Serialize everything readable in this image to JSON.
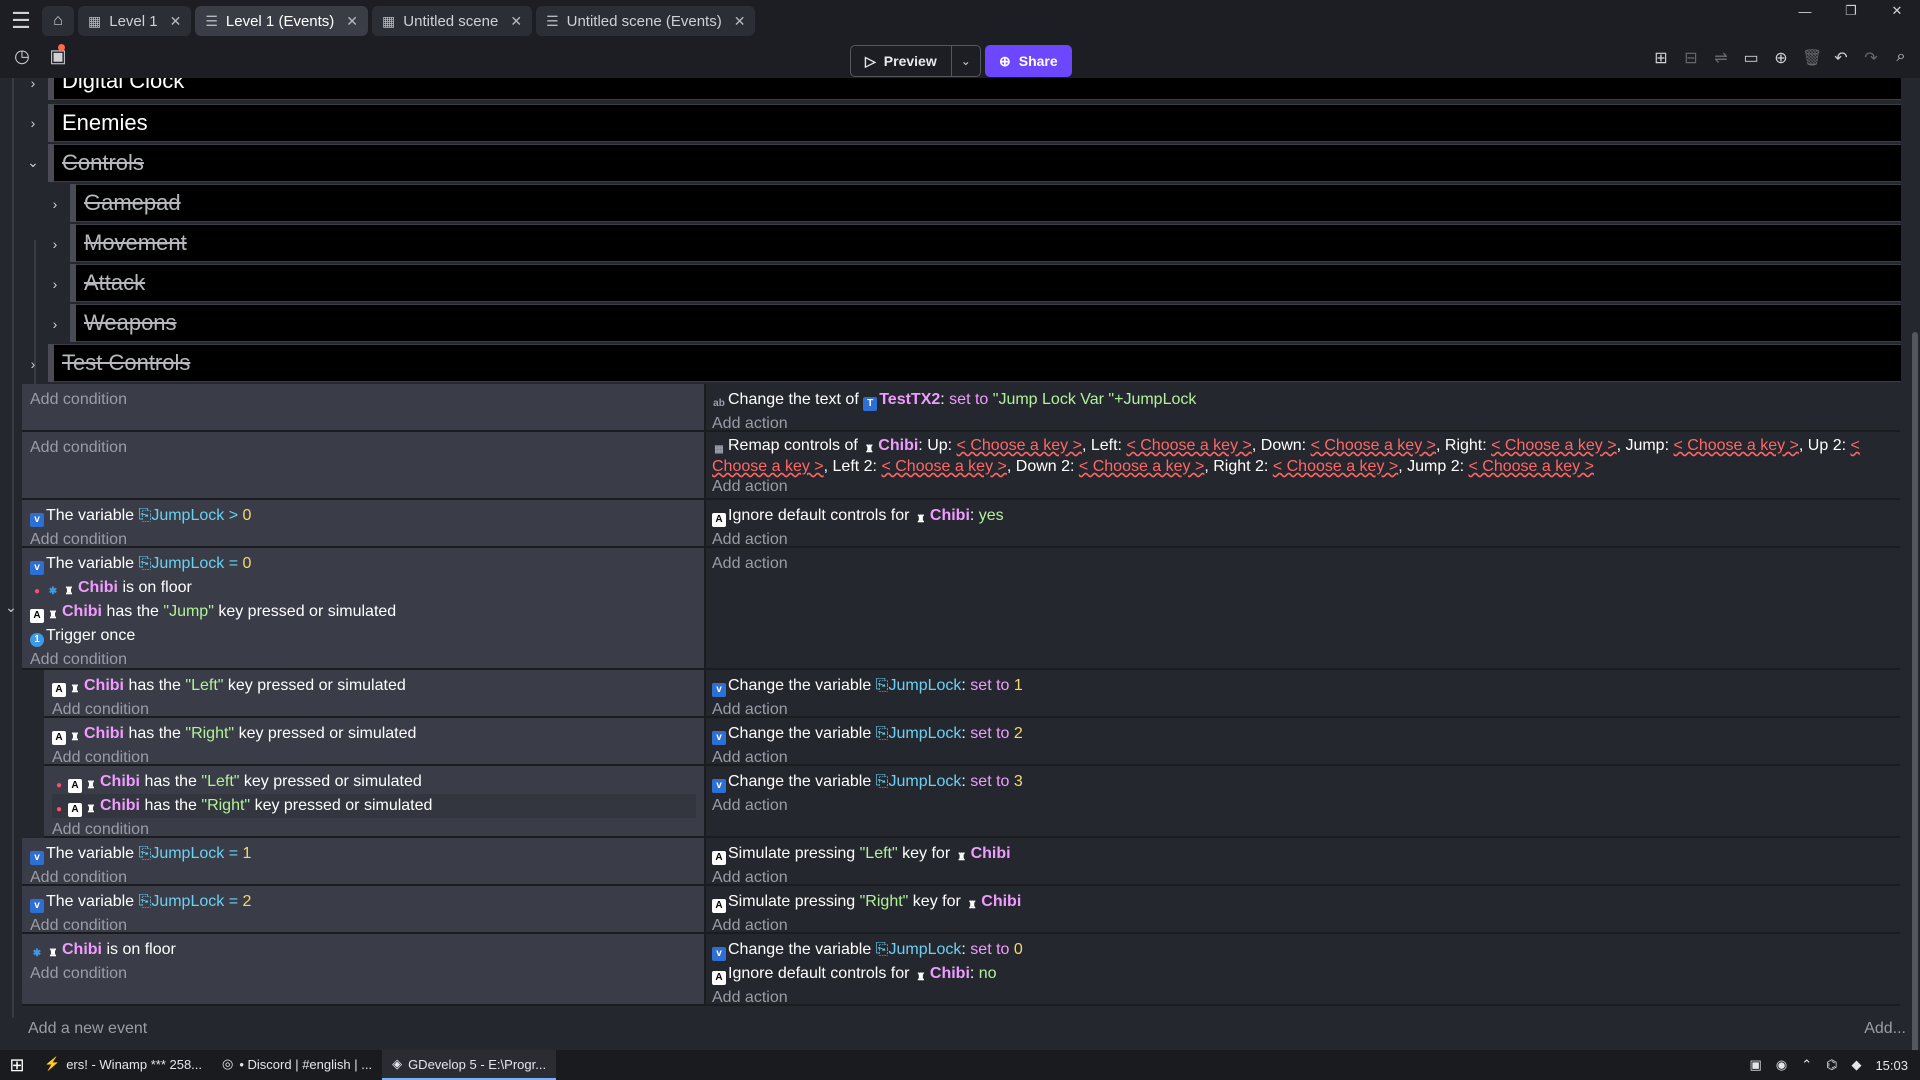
{
  "tabs": [
    {
      "label": "Level 1",
      "icon": "scene-icon"
    },
    {
      "label": "Level 1 (Events)",
      "icon": "events-icon",
      "active": true
    },
    {
      "label": "Untitled scene",
      "icon": "scene-icon"
    },
    {
      "label": "Untitled scene (Events)",
      "icon": "events-icon"
    }
  ],
  "toolbar": {
    "preview": "Preview",
    "share": "Share"
  },
  "groups": [
    {
      "title": "Digital Clock",
      "disabled": false,
      "level": 0,
      "expanded": false
    },
    {
      "title": "Enemies",
      "disabled": false,
      "level": 0,
      "expanded": false
    },
    {
      "title": "Controls",
      "disabled": true,
      "level": 0,
      "expanded": true
    },
    {
      "title": "Gamepad",
      "disabled": true,
      "level": 1,
      "expanded": false
    },
    {
      "title": "Movement",
      "disabled": true,
      "level": 1,
      "expanded": false
    },
    {
      "title": "Attack",
      "disabled": true,
      "level": 1,
      "expanded": false
    },
    {
      "title": "Weapons",
      "disabled": true,
      "level": 1,
      "expanded": false
    },
    {
      "title": "Test Controls",
      "disabled": true,
      "level": 0,
      "expanded": false
    }
  ],
  "labels": {
    "add_condition": "Add condition",
    "add_action": "Add action",
    "add_event": "Add a new event",
    "add_more": "Add..."
  },
  "text": {
    "change_text_of": "Change the text of",
    "testtx2": "TestTX2",
    "set_to": "set to",
    "jump_lock_expr": "\"Jump Lock Var \"+JumpLock",
    "remap_controls_of": "Remap controls of",
    "chibi": "Chibi",
    "up": "Up:",
    "left": "Left:",
    "down": "Down:",
    "right": "Right:",
    "jump": "Jump:",
    "up2": "Up 2:",
    "left2": "Left 2:",
    "down2": "Down 2:",
    "right2": "Right 2:",
    "jump2": "Jump 2:",
    "choose_key": "< Choose a key >",
    "ignore_default": "Ignore default controls for",
    "yes": "yes",
    "no": "no",
    "the_variable": "The variable",
    "jumplock": "JumpLock",
    "gt": ">",
    "eq": "=",
    "v0": "0",
    "v1": "1",
    "v2": "2",
    "v3": "3",
    "is_on_floor": "is on floor",
    "has_the": "has the",
    "key_pressed": "key pressed or simulated",
    "jump_key": "\"Jump\"",
    "left_key": "\"Left\"",
    "right_key": "\"Right\"",
    "trigger_once": "Trigger once",
    "change_variable": "Change the variable",
    "simulate_pressing": "Simulate pressing",
    "key_for": "key for"
  },
  "taskbar": [
    {
      "label": "ers! - Winamp *** 258...",
      "icon": "winamp-icon"
    },
    {
      "label": "• Discord | #english | ...",
      "icon": "discord-icon"
    },
    {
      "label": "GDevelop 5 - E:\\Progr...",
      "icon": "gdevelop-icon",
      "active": true
    }
  ],
  "clock": "15:03"
}
